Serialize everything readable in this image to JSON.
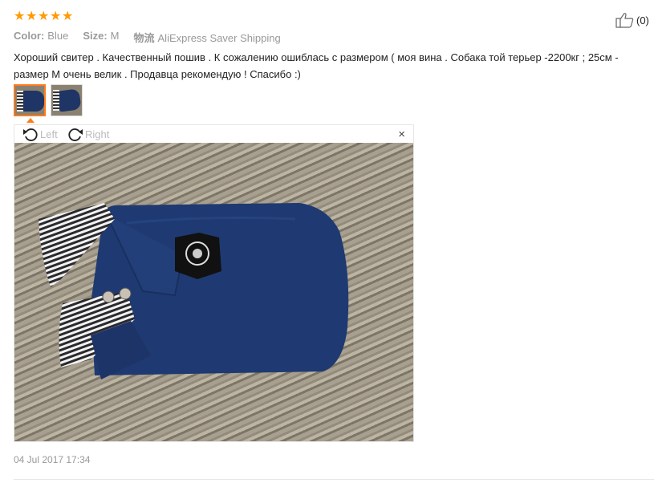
{
  "review": {
    "rating": 5,
    "color_label": "Color:",
    "color_value": "Blue",
    "size_label": "Size:",
    "size_value": "M",
    "shipping_from": "物流",
    "shipping_method": "AliExpress Saver Shipping",
    "helpful_count": "(0)",
    "text": "Хороший свитер . Качественный пошив . К сожалению ошиблась с размером ( моя вина . Собака той терьер -2200кг ; 25см - размер М очень велик . Продавца рекомендую ! Спасибо :)",
    "date": "04 Jul 2017 17:34"
  },
  "viewer": {
    "rotate_left_label": "Left",
    "rotate_right_label": "Right",
    "close_symbol": "×"
  },
  "icons": {
    "star": "star-icon",
    "thumb": "thumbs-up-icon",
    "rotate_left": "rotate-left-icon",
    "rotate_right": "rotate-right-icon",
    "close": "close-icon"
  },
  "colors": {
    "star": "#ff9a00",
    "active_thumb_border": "#ff7b1c",
    "muted_text": "#999999"
  }
}
